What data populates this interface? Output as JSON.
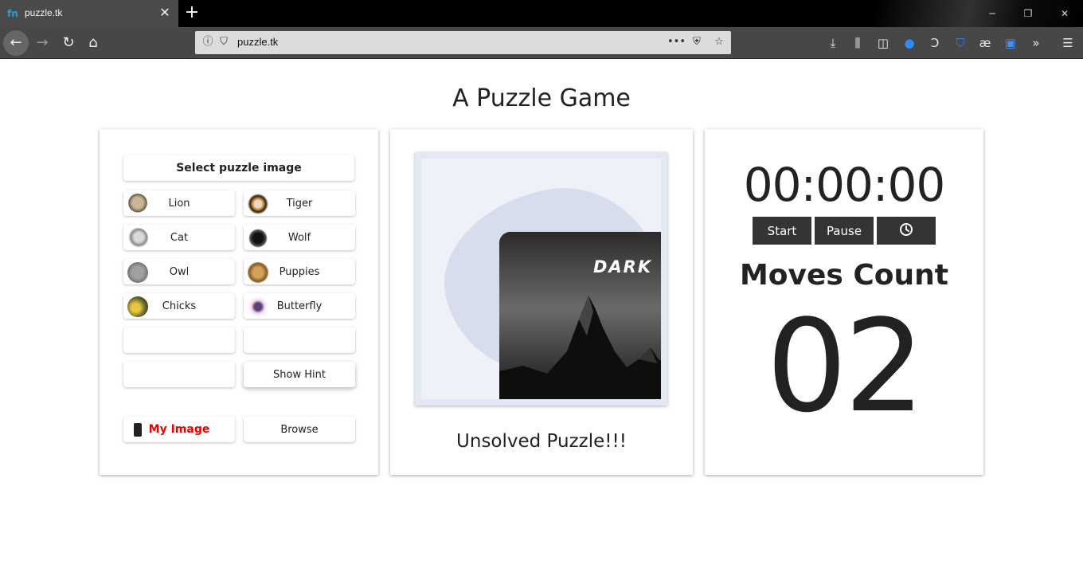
{
  "browser": {
    "tab_title": "puzzle.tk",
    "favicon_text": "fn",
    "url": "puzzle.tk",
    "icons": [
      "back-icon",
      "forward-icon",
      "reload-icon",
      "home-icon",
      "info-icon",
      "shield-icon",
      "more-icon",
      "pocket-icon",
      "star-icon",
      "download-icon",
      "library-icon",
      "sidebar-icon",
      "messenger-icon",
      "extension-icon",
      "shield-ext-icon",
      "ae-icon",
      "translate-icon",
      "overflow-icon",
      "menu-icon"
    ]
  },
  "page": {
    "title": "A Puzzle Game"
  },
  "selector": {
    "heading": "Select puzzle image",
    "images": [
      "Lion",
      "Tiger",
      "Cat",
      "Wolf",
      "Owl",
      "Puppies",
      "Chicks",
      "Butterfly"
    ],
    "hint_label": "Show Hint",
    "my_image_label": "My Image",
    "browse_label": "Browse"
  },
  "board": {
    "overlay_word": "DARK",
    "status": "Unsolved Puzzle!!!"
  },
  "timer": {
    "value": "00:00:00",
    "start_label": "Start",
    "pause_label": "Pause"
  },
  "moves": {
    "title": "Moves Count",
    "count": "02"
  },
  "colors": {
    "accent_dark": "#343434",
    "my_image_red": "#e00000"
  }
}
